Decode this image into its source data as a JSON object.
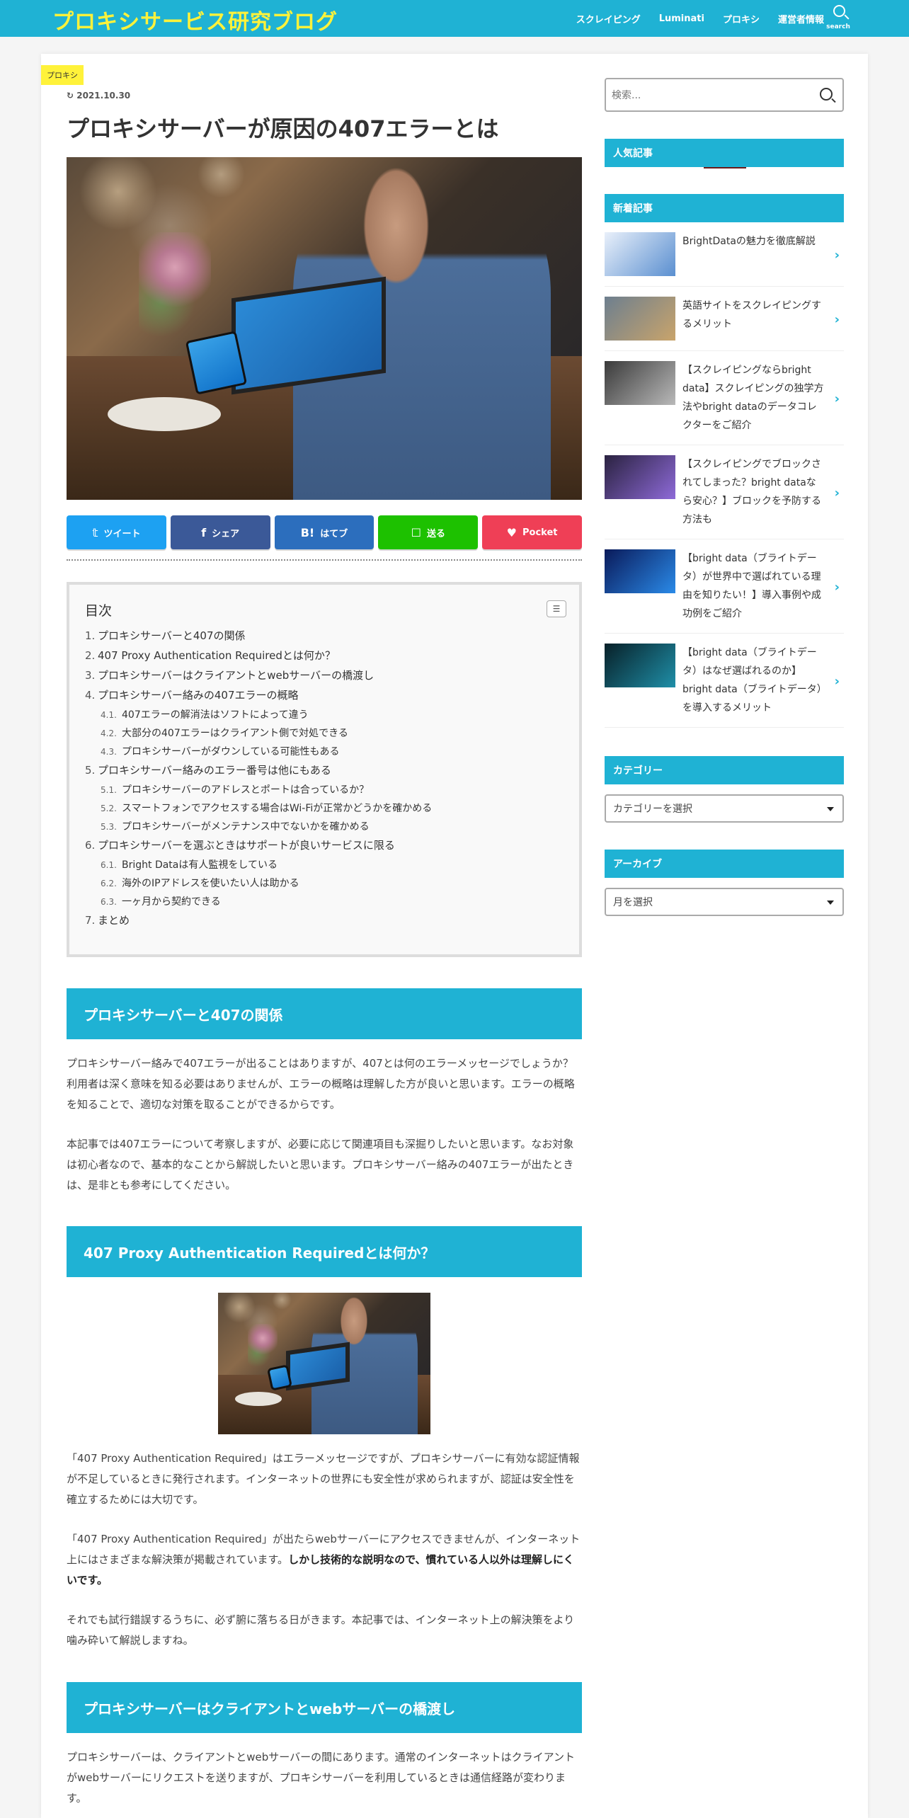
{
  "header": {
    "site_title": "プロキシサービス研究ブログ",
    "nav": [
      "スクレイピング",
      "Luminati",
      "プロキシ",
      "運営者情報"
    ],
    "search_label": "search"
  },
  "post": {
    "category": "プロキシ",
    "date": "2021.10.30",
    "title": "プロキシサーバーが原因の407エラーとは"
  },
  "share": [
    {
      "label": "ツイート",
      "color": "#1da1f2",
      "icon": "twitter-icon",
      "glyph": "𝕥"
    },
    {
      "label": "シェア",
      "color": "#3b5998",
      "icon": "facebook-icon",
      "glyph": "f"
    },
    {
      "label": "はてブ",
      "color": "#2c6ebd",
      "icon": "hatena-icon",
      "glyph": "B!"
    },
    {
      "label": "送る",
      "color": "#1dc100",
      "icon": "line-icon",
      "glyph": "☐"
    },
    {
      "label": "Pocket",
      "color": "#ef3f56",
      "icon": "pocket-icon",
      "glyph": "♥"
    }
  ],
  "toc": {
    "title": "目次",
    "items": [
      {
        "n": "1.",
        "label": "プロキシサーバーと407の関係",
        "subs": []
      },
      {
        "n": "2.",
        "label": "407 Proxy Authentication Requiredとは何か？",
        "subs": []
      },
      {
        "n": "3.",
        "label": "プロキシサーバーはクライアントとwebサーバーの橋渡し",
        "subs": []
      },
      {
        "n": "4.",
        "label": "プロキシサーバー絡みの407エラーの概略",
        "subs": [
          {
            "n": "4.1.",
            "label": "407エラーの解消法はソフトによって違う"
          },
          {
            "n": "4.2.",
            "label": "大部分の407エラーはクライアント側で対処できる"
          },
          {
            "n": "4.3.",
            "label": "プロキシサーバーがダウンしている可能性もある"
          }
        ]
      },
      {
        "n": "5.",
        "label": "プロキシサーバー絡みのエラー番号は他にもある",
        "subs": [
          {
            "n": "5.1.",
            "label": "プロキシサーバーのアドレスとポートは合っているか？"
          },
          {
            "n": "5.2.",
            "label": "スマートフォンでアクセスする場合はWi-Fiが正常かどうかを確かめる"
          },
          {
            "n": "5.3.",
            "label": "プロキシサーバーがメンテナンス中でないかを確かめる"
          }
        ]
      },
      {
        "n": "6.",
        "label": "プロキシサーバーを選ぶときはサポートが良いサービスに限る",
        "subs": [
          {
            "n": "6.1.",
            "label": "Bright Dataは有人監視をしている"
          },
          {
            "n": "6.2.",
            "label": "海外のIPアドレスを使いたい人は助かる"
          },
          {
            "n": "6.3.",
            "label": "一ヶ月から契約できる"
          }
        ]
      },
      {
        "n": "7.",
        "label": "まとめ",
        "subs": []
      }
    ]
  },
  "sections": {
    "s1_heading": "プロキシサーバーと407の関係",
    "s1_p1": "プロキシサーバー絡みで407エラーが出ることはありますが、407とは何のエラーメッセージでしょうか？利用者は深く意味を知る必要はありませんが、エラーの概略は理解した方が良いと思います。エラーの概略を知ることで、適切な対策を取ることができるからです。",
    "s1_p2": "本記事では407エラーについて考察しますが、必要に応じて関連項目も深掘りしたいと思います。なお対象は初心者なので、基本的なことから解説したいと思います。プロキシサーバー絡みの407エラーが出たときは、是非とも参考にしてください。",
    "s2_heading": "407 Proxy Authentication Requiredとは何か？",
    "s2_p1": "「407 Proxy Authentication Required」はエラーメッセージですが、プロキシサーバーに有効な認証情報が不足しているときに発行されます。インターネットの世界にも安全性が求められますが、認証は安全性を確立するためには大切です。",
    "s2_p2_a": "「407 Proxy Authentication Required」が出たらwebサーバーにアクセスできませんが、インターネット上にはさまざまな解決策が掲載されています。",
    "s2_p2_b": "しかし技術的な説明なので、慣れている人以外は理解しにくいです。",
    "s2_p3": "それでも試行錯誤するうちに、必ず腑に落ちる日がきます。本記事では、インターネット上の解決策をより噛み砕いて解説しますね。",
    "s3_heading": "プロキシサーバーはクライアントとwebサーバーの橋渡し",
    "s3_p1": "プロキシサーバーは、クライアントとwebサーバーの間にあります。通常のインターネットはクライアントがwebサーバーにリクエストを送りますが、プロキシサーバーを利用しているときは通信経路が変わります。"
  },
  "sidebar": {
    "search_placeholder": "検索...",
    "popular_title": "人気記事",
    "recent_title": "新着記事",
    "recent": [
      {
        "title": "BrightDataの魅力を徹底解説",
        "colors": [
          "#e9f0fa",
          "#5a8fd0"
        ]
      },
      {
        "title": "英語サイトをスクレイピングするメリット",
        "colors": [
          "#6d7f8f",
          "#c9a46b"
        ]
      },
      {
        "title": "【スクレイピングならbright data】スクレイピングの独学方法やbright dataのデータコレクターをご紹介",
        "colors": [
          "#3a3a3a",
          "#b9b9b9"
        ]
      },
      {
        "title": "【スクレイピングでブロックされてしまった？bright dataなら安心？】ブロックを予防する方法も",
        "colors": [
          "#2a2240",
          "#8e6ad8"
        ]
      },
      {
        "title": "【bright data（ブライトデータ）が世界中で選ばれている理由を知りたい！】導入事例や成功例をご紹介",
        "colors": [
          "#0a1a5a",
          "#2a8ae8"
        ]
      },
      {
        "title": "【bright data（ブライトデータ）はなぜ選ばれるのか】bright data（ブライトデータ）を導入するメリット",
        "colors": [
          "#082028",
          "#1f8fa8"
        ]
      }
    ],
    "category_title": "カテゴリー",
    "category_select": "カテゴリーを選択",
    "archive_title": "アーカイブ",
    "archive_select": "月を選択"
  }
}
